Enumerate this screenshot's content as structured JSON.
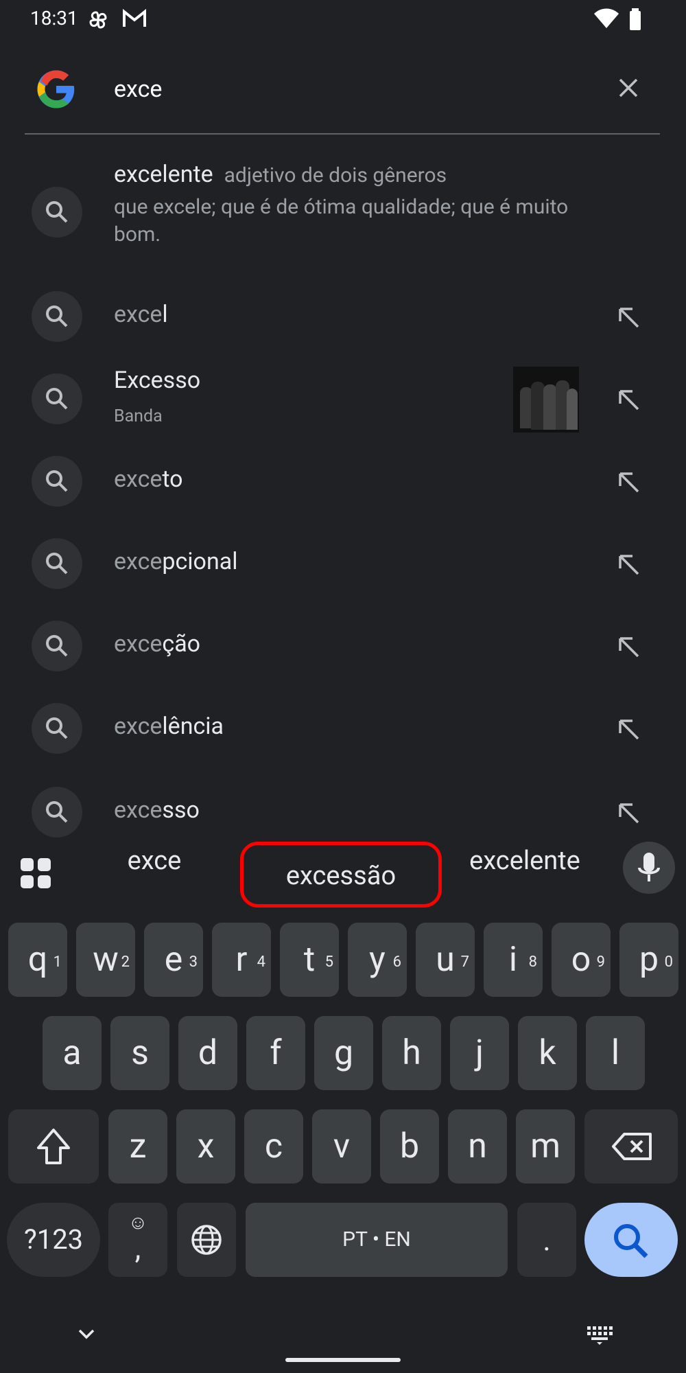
{
  "status_bar": {
    "time": "18:31"
  },
  "search": {
    "query": "exce"
  },
  "definition": {
    "word": "excelente",
    "pos": "adjetivo de dois gêneros",
    "line1": "que excele; que é de ótima qualidade; que é muito",
    "line2": "bom."
  },
  "suggestions": [
    {
      "typed": "exce",
      "rest": "l"
    },
    {
      "title": "Excesso",
      "subtitle": "Banda"
    },
    {
      "typed": "exce",
      "rest": "to"
    },
    {
      "typed": "exce",
      "rest": "pcional"
    },
    {
      "typed": "exce",
      "rest": "ção"
    },
    {
      "typed": "exce",
      "rest": "lência"
    },
    {
      "typed": "exce",
      "rest": "sso"
    }
  ],
  "keyboard": {
    "candidates": [
      "exce",
      "excessão",
      "excelente"
    ],
    "highlight_color": "#ff0000",
    "row1": [
      {
        "k": "q",
        "h": "1"
      },
      {
        "k": "w",
        "h": "2"
      },
      {
        "k": "e",
        "h": "3"
      },
      {
        "k": "r",
        "h": "4"
      },
      {
        "k": "t",
        "h": "5"
      },
      {
        "k": "y",
        "h": "6"
      },
      {
        "k": "u",
        "h": "7"
      },
      {
        "k": "i",
        "h": "8"
      },
      {
        "k": "o",
        "h": "9"
      },
      {
        "k": "p",
        "h": "0"
      }
    ],
    "row2": [
      "a",
      "s",
      "d",
      "f",
      "g",
      "h",
      "j",
      "k",
      "l"
    ],
    "row3": [
      "z",
      "x",
      "c",
      "v",
      "b",
      "n",
      "m"
    ],
    "symbols_label": "?123",
    "emoji_comma": ",",
    "space_label": "PT • EN",
    "period": ".",
    "accent": "#a8c7fa"
  }
}
